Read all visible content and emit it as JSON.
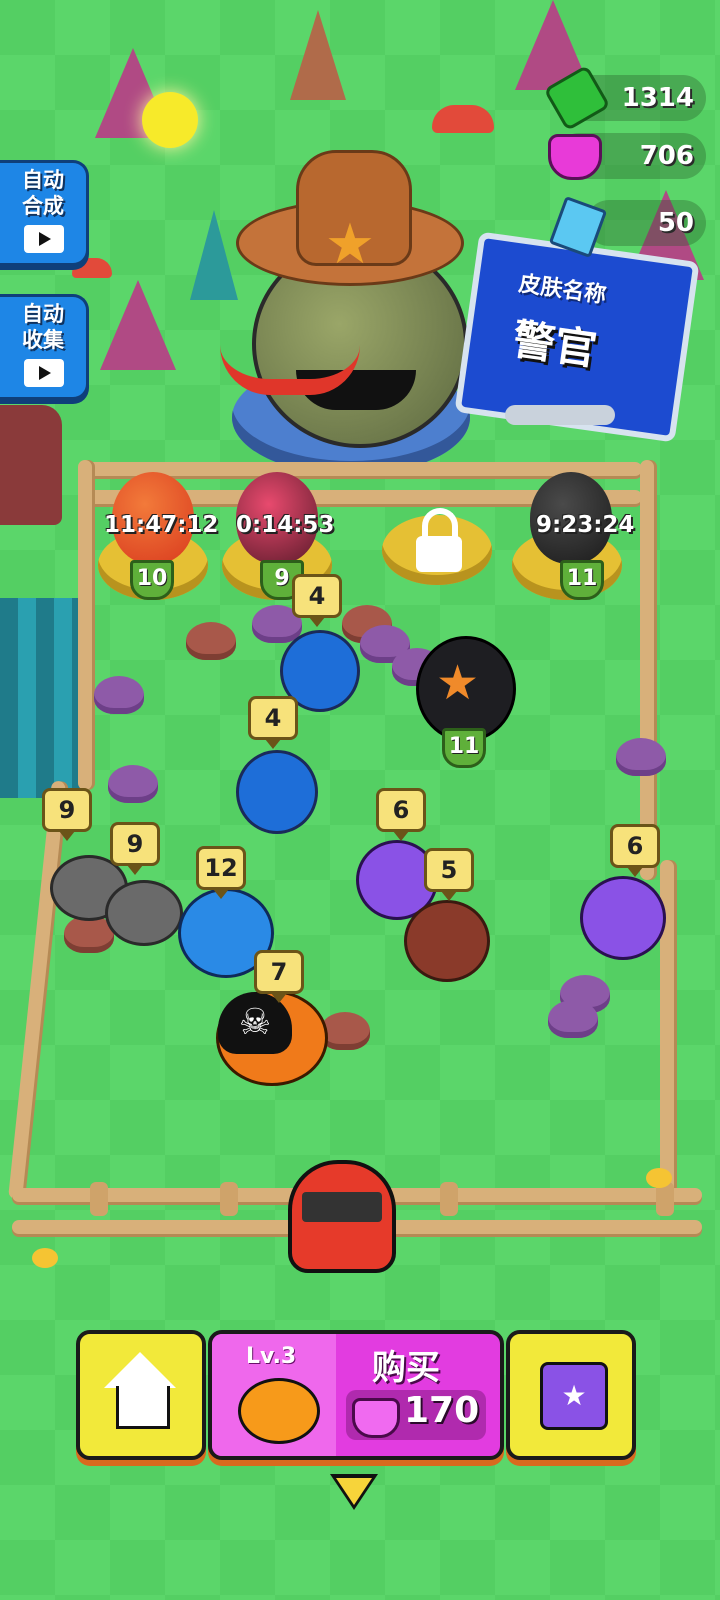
{
  "currencies": [
    {
      "name": "cash",
      "icon": "green-cash-icon",
      "value": "1314"
    },
    {
      "name": "gems",
      "icon": "pink-gem-icon",
      "value": "706"
    },
    {
      "name": "crystals",
      "icon": "blue-crystal-icon",
      "value": "50"
    }
  ],
  "side_buttons": {
    "auto_merge": {
      "label1": "自动",
      "label2": "合成"
    },
    "auto_collect": {
      "label1": "自动",
      "label2": "收集"
    }
  },
  "skin_board": {
    "line1": "皮肤名称",
    "line2": "警官"
  },
  "nests": [
    {
      "timer": "11:47:12",
      "level": "10",
      "egg_color": "#d93a1e"
    },
    {
      "timer": "0:14:53",
      "level": "9",
      "egg_color": "#c22a4e"
    },
    {
      "locked": true
    },
    {
      "timer": "9:23:24",
      "level": "11",
      "egg_color": "#2a2a2a"
    }
  ],
  "monster_levels": {
    "m4a": "4",
    "m11": "11",
    "m4b": "4",
    "m9a": "9",
    "m9b": "9",
    "m12": "12",
    "m6a": "6",
    "m5": "5",
    "m6b": "6",
    "m7": "7"
  },
  "bottom_bar": {
    "buy_level": "Lv.3",
    "buy_label": "购买",
    "buy_price": "170",
    "accent_colors": {
      "buy": "#e23ce0",
      "home": "#f2e93a",
      "shop": "#f2e93a"
    }
  }
}
